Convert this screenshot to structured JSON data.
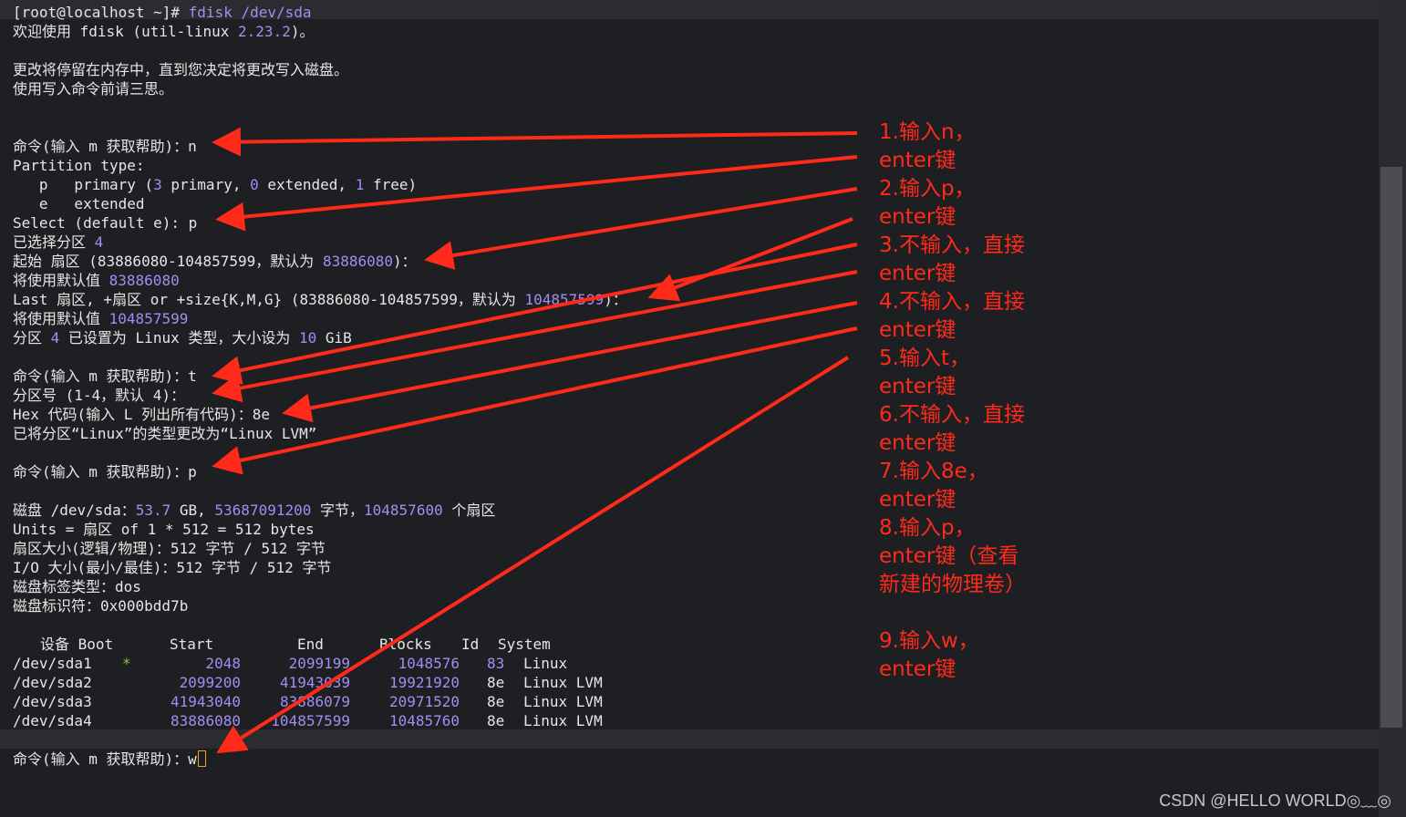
{
  "terminal": {
    "prompt": "[root@localhost ~]#",
    "command": " fdisk /dev/sda",
    "welcome_pre": "欢迎使用 fdisk (util-linux ",
    "welcome_ver": "2.23.2",
    "welcome_post": ")。",
    "notice1": "更改将停留在内存中，直到您决定将更改写入磁盘。",
    "notice2": "使用写入命令前请三思。",
    "cmd_n": "命令(输入 m 获取帮助)：n",
    "ptype": "Partition type:",
    "ptype_p_pre": "   p   primary (",
    "ptype_p_n1": "3",
    "ptype_p_mid1": " primary, ",
    "ptype_p_n2": "0",
    "ptype_p_mid2": " extended, ",
    "ptype_p_n3": "1",
    "ptype_p_post": " free)",
    "ptype_e": "   e   extended",
    "select": "Select (default e): p",
    "selected_pre": "已选择分区 ",
    "selected_num": "4",
    "start_pre": "起始 扇区 (83886080-104857599，默认为 ",
    "start_val": "83886080",
    "start_post": ")：",
    "default1_pre": "将使用默认值 ",
    "default1_val": "83886080",
    "last_pre": "Last 扇区, +扇区 or +size{K,M,G} (83886080-104857599，默认为 ",
    "last_val": "104857599",
    "last_post": ")：",
    "default2_pre": "将使用默认值 ",
    "default2_val": "104857599",
    "set_pre": "分区 ",
    "set_num": "4",
    "set_mid": " 已设置为 Linux 类型，大小设为 ",
    "set_size": "10",
    "set_post": " GiB",
    "cmd_t": "命令(输入 m 获取帮助)：t",
    "partno": "分区号 (1-4，默认 4)：",
    "hex": "Hex 代码(输入 L 列出所有代码)：8e",
    "changed": "已将分区“Linux”的类型更改为“Linux LVM”",
    "cmd_p": "命令(输入 m 获取帮助)：p",
    "disk_pre": "磁盘 /dev/sda：",
    "disk_gb": "53.7",
    "disk_mid": " GB, ",
    "disk_bytes": "53687091200",
    "disk_mid2": " 字节，",
    "disk_sectors": "104857600",
    "disk_post": " 个扇区",
    "units": "Units = 扇区 of 1 * 512 = 512 bytes",
    "sector_size": "扇区大小(逻辑/物理)：512 字节 / 512 字节",
    "io_size": "I/O 大小(最小/最佳)：512 字节 / 512 字节",
    "label_type": "磁盘标签类型：dos",
    "identifier": "磁盘标识符：0x000bdd7b",
    "cmd_w": "命令(输入 m 获取帮助)：w"
  },
  "table": {
    "headers": [
      "设备 Boot",
      "Start",
      "End",
      "Blocks",
      "Id",
      "System"
    ],
    "rows": [
      {
        "device": "/dev/sda1",
        "boot": "*",
        "start": "2048",
        "end": "2099199",
        "blocks": "1048576",
        "id": "83",
        "system": "Linux"
      },
      {
        "device": "/dev/sda2",
        "boot": "",
        "start": "2099200",
        "end": "41943039",
        "blocks": "19921920",
        "id": "8e",
        "system": "Linux LVM"
      },
      {
        "device": "/dev/sda3",
        "boot": "",
        "start": "41943040",
        "end": "83886079",
        "blocks": "20971520",
        "id": "8e",
        "system": "Linux LVM"
      },
      {
        "device": "/dev/sda4",
        "boot": "",
        "start": "83886080",
        "end": "104857599",
        "blocks": "10485760",
        "id": "8e",
        "system": "Linux LVM"
      }
    ]
  },
  "annotations": [
    "1.输入n，enter键",
    "2.输入p，enter键",
    "3.不输入，直接enter键",
    "4.不输入，直接enter键",
    "5.输入t，enter键",
    "6.不输入，直接enter键",
    "7.输入8e，enter键",
    "8.输入p，enter键（查看新建的物理卷）",
    "9.输入w，enter键"
  ],
  "watermark": "CSDN @HELLO WORLD◎﹏◎",
  "colors": {
    "background": "#1e1f22",
    "text": "#e6e6e6",
    "number": "#a58cf0",
    "annotation": "#ff2a1a",
    "boot_flag": "#7ac943"
  },
  "icons": {
    "arrow": "red-arrow-icon",
    "cursor": "block-cursor-icon"
  }
}
